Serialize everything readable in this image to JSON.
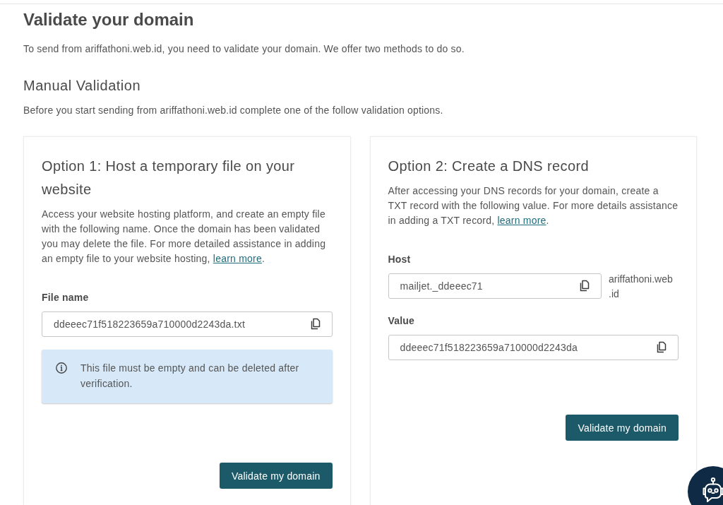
{
  "page": {
    "title": "Validate your domain",
    "intro": "To send from ariffathoni.web.id, you need to validate your domain. We offer two methods to do so."
  },
  "manual_validation": {
    "heading": "Manual Validation",
    "description": "Before you start sending from ariffathoni.web.id complete one of the follow validation options.",
    "options": [
      {
        "title": "Option 1: Host a temporary file on your website",
        "description": "Access your website hosting platform, and create an empty file with the following name. Once the domain has been validated you may delete the file. For more detailed assistance in adding an empty file to your website hosting,",
        "link": "learn more",
        "link_suffix": ".",
        "fields": [
          {
            "label": "File name",
            "value": "ddeeec71f518223659a710000d2243da.txt"
          }
        ],
        "notice": "This file must be empty and can be deleted after verification.",
        "button": "Validate my domain"
      },
      {
        "title": "Option 2: Create a DNS record",
        "description": "After accessing your DNS records for your domain, create a TXT record with the following value. For more details assistance in adding a TXT record,",
        "link": "learn more",
        "link_suffix": ".",
        "fields": [
          {
            "label": "Host",
            "value": "mailjet._ddeeec71",
            "suffix": "ariffathoni.web.id"
          },
          {
            "label": "Value",
            "value": "ddeeec71f518223659a710000d2243da"
          }
        ],
        "button": "Validate my domain"
      }
    ]
  }
}
